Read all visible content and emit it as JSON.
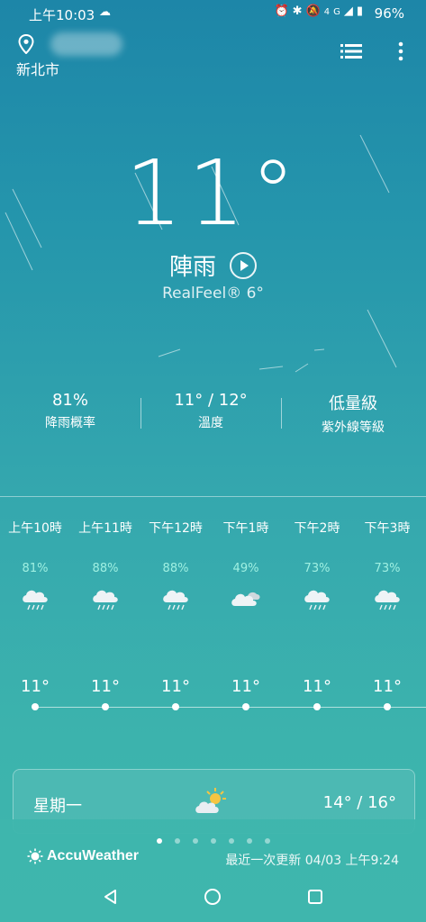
{
  "status_bar": {
    "time": "上午10:03",
    "network": "4G",
    "battery": "96%"
  },
  "header": {
    "city": "新北市"
  },
  "current": {
    "temperature": "11°",
    "condition": "陣雨",
    "realfeel": "RealFeel® 6°"
  },
  "stats": [
    {
      "value": "81%",
      "label": "降雨概率"
    },
    {
      "value": "11° / 12°",
      "label": "溫度"
    },
    {
      "value": "低量級",
      "label": "紫外線等級"
    }
  ],
  "hourly": [
    {
      "time": "上午10時",
      "precip": "81%",
      "icon": "cloud-rain-icon",
      "temp": "11°"
    },
    {
      "time": "上午11時",
      "precip": "88%",
      "icon": "cloud-rain-icon",
      "temp": "11°"
    },
    {
      "time": "下午12時",
      "precip": "88%",
      "icon": "cloud-rain-icon",
      "temp": "11°"
    },
    {
      "time": "下午1時",
      "precip": "49%",
      "icon": "cloudy-icon",
      "temp": "11°"
    },
    {
      "time": "下午2時",
      "precip": "73%",
      "icon": "cloud-rain-icon",
      "temp": "11°"
    },
    {
      "time": "下午3時",
      "precip": "73%",
      "icon": "cloud-rain-icon",
      "temp": "11°"
    }
  ],
  "daily": {
    "day": "星期一",
    "icon": "partly-sunny-icon",
    "temps": "14° / 16°"
  },
  "pager": {
    "count": 7,
    "active": 0
  },
  "footer": {
    "brand": "AccuWeather",
    "updated": "最近一次更新 04/03 上午9:24"
  }
}
